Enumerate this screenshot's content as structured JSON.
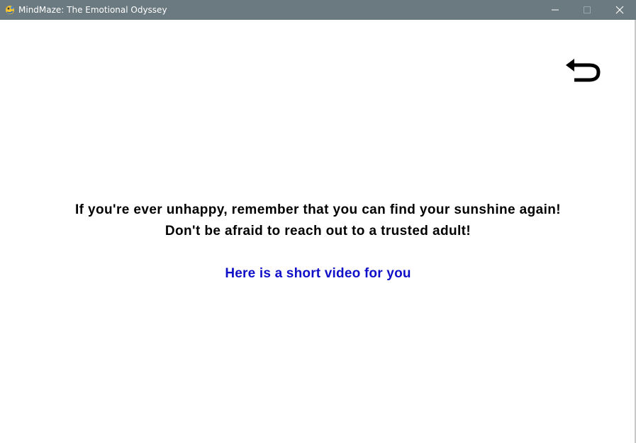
{
  "window": {
    "title": "MindMaze: The Emotional Odyssey",
    "app_icon": "pygame-snake-icon",
    "controls": [
      "minimize-icon",
      "maximize-icon",
      "close-icon"
    ],
    "titlebar_color": "#6b7a80"
  },
  "content": {
    "back_icon": "back-arrow-icon",
    "message_line1": "If you're ever unhappy, remember that you can find your sunshine again!",
    "message_line2": "Don't be afraid to reach out to a trusted adult!",
    "video_link": "Here is a short video for you",
    "link_color": "#1010c8"
  }
}
